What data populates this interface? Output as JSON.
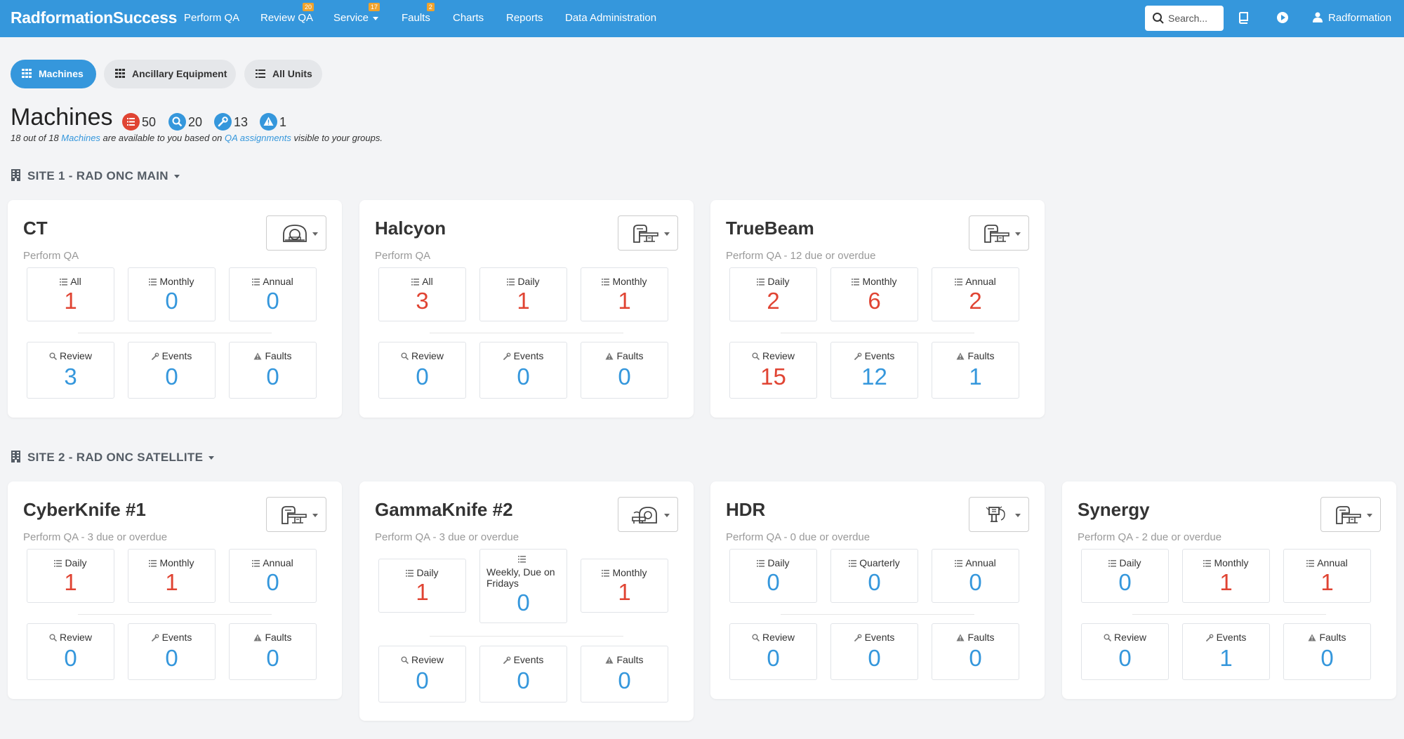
{
  "nav": {
    "brand": "RadformationSuccess",
    "items": [
      {
        "label": "Perform QA",
        "badge": null
      },
      {
        "label": "Review QA",
        "badge": "20"
      },
      {
        "label": "Service",
        "badge": "17",
        "dropdown": true
      },
      {
        "label": "Faults",
        "badge": "2"
      },
      {
        "label": "Charts",
        "badge": null
      },
      {
        "label": "Reports",
        "badge": null
      },
      {
        "label": "Data Administration",
        "badge": null
      }
    ],
    "search_placeholder": "Search...",
    "user": "Radformation",
    "icons": [
      "book-icon",
      "play-icon",
      "user-icon"
    ]
  },
  "tabs": [
    {
      "label": "Machines",
      "active": true
    },
    {
      "label": "Ancillary Equipment",
      "active": false
    },
    {
      "label": "All Units",
      "active": false
    }
  ],
  "page": {
    "title": "Machines",
    "stats": [
      {
        "icon": "list-icon",
        "value": "50",
        "color": "#e04433"
      },
      {
        "icon": "search-icon",
        "value": "20",
        "color": "#3597dc"
      },
      {
        "icon": "wrench-icon",
        "value": "13",
        "color": "#3597dc"
      },
      {
        "icon": "warning-icon",
        "value": "1",
        "color": "#3597dc"
      }
    ],
    "subtitle": {
      "p1": "18 out of 18 ",
      "link1": "Machines",
      "p2": " are available to you based on ",
      "link2": "QA assignments",
      "p3": " visible to your groups."
    }
  },
  "sites": [
    {
      "name": "SITE 1 - RAD ONC MAIN",
      "machines": [
        {
          "name": "CT",
          "sub": "Perform QA",
          "icon": "ct-scanner-icon",
          "qa": [
            {
              "label": "All",
              "value": "1",
              "alert": true
            },
            {
              "label": "Monthly",
              "value": "0",
              "alert": false
            },
            {
              "label": "Annual",
              "value": "0",
              "alert": false
            }
          ],
          "stats": [
            {
              "label": "Review",
              "value": "3",
              "alert": false
            },
            {
              "label": "Events",
              "value": "0",
              "alert": false
            },
            {
              "label": "Faults",
              "value": "0",
              "alert": false
            }
          ]
        },
        {
          "name": "Halcyon",
          "sub": "Perform QA",
          "icon": "linac-icon",
          "qa": [
            {
              "label": "All",
              "value": "3",
              "alert": true
            },
            {
              "label": "Daily",
              "value": "1",
              "alert": true
            },
            {
              "label": "Monthly",
              "value": "1",
              "alert": true
            }
          ],
          "stats": [
            {
              "label": "Review",
              "value": "0",
              "alert": false
            },
            {
              "label": "Events",
              "value": "0",
              "alert": false
            },
            {
              "label": "Faults",
              "value": "0",
              "alert": false
            }
          ]
        },
        {
          "name": "TrueBeam",
          "sub": "Perform QA - 12 due or overdue",
          "icon": "linac-icon",
          "qa": [
            {
              "label": "Daily",
              "value": "2",
              "alert": true
            },
            {
              "label": "Monthly",
              "value": "6",
              "alert": true
            },
            {
              "label": "Annual",
              "value": "2",
              "alert": true
            }
          ],
          "stats": [
            {
              "label": "Review",
              "value": "15",
              "alert": true
            },
            {
              "label": "Events",
              "value": "12",
              "alert": false
            },
            {
              "label": "Faults",
              "value": "1",
              "alert": false
            }
          ]
        }
      ]
    },
    {
      "name": "SITE 2 - RAD ONC SATELLITE",
      "machines": [
        {
          "name": "CyberKnife #1",
          "sub": "Perform QA - 3 due or overdue",
          "icon": "linac-icon",
          "qa": [
            {
              "label": "Daily",
              "value": "1",
              "alert": true
            },
            {
              "label": "Monthly",
              "value": "1",
              "alert": true
            },
            {
              "label": "Annual",
              "value": "0",
              "alert": false
            }
          ],
          "stats": [
            {
              "label": "Review",
              "value": "0",
              "alert": false
            },
            {
              "label": "Events",
              "value": "0",
              "alert": false
            },
            {
              "label": "Faults",
              "value": "0",
              "alert": false
            }
          ]
        },
        {
          "name": "GammaKnife #2",
          "sub": "Perform QA - 3 due or overdue",
          "icon": "gammaknife-icon",
          "qa": [
            {
              "label": "Daily",
              "value": "1",
              "alert": true
            },
            {
              "label": "Weekly, Due on Fridays",
              "value": "0",
              "alert": false
            },
            {
              "label": "Monthly",
              "value": "1",
              "alert": true
            }
          ],
          "stats": [
            {
              "label": "Review",
              "value": "0",
              "alert": false
            },
            {
              "label": "Events",
              "value": "0",
              "alert": false
            },
            {
              "label": "Faults",
              "value": "0",
              "alert": false
            }
          ]
        },
        {
          "name": "HDR",
          "sub": "Perform QA - 0 due or overdue",
          "icon": "hdr-icon",
          "qa": [
            {
              "label": "Daily",
              "value": "0",
              "alert": false
            },
            {
              "label": "Quarterly",
              "value": "0",
              "alert": false
            },
            {
              "label": "Annual",
              "value": "0",
              "alert": false
            }
          ],
          "stats": [
            {
              "label": "Review",
              "value": "0",
              "alert": false
            },
            {
              "label": "Events",
              "value": "0",
              "alert": false
            },
            {
              "label": "Faults",
              "value": "0",
              "alert": false
            }
          ]
        },
        {
          "name": "Synergy",
          "sub": "Perform QA - 2 due or overdue",
          "icon": "linac-icon",
          "qa": [
            {
              "label": "Daily",
              "value": "0",
              "alert": false
            },
            {
              "label": "Monthly",
              "value": "1",
              "alert": true
            },
            {
              "label": "Annual",
              "value": "1",
              "alert": true
            }
          ],
          "stats": [
            {
              "label": "Review",
              "value": "0",
              "alert": false
            },
            {
              "label": "Events",
              "value": "1",
              "alert": false
            },
            {
              "label": "Faults",
              "value": "0",
              "alert": false
            }
          ]
        }
      ]
    }
  ]
}
